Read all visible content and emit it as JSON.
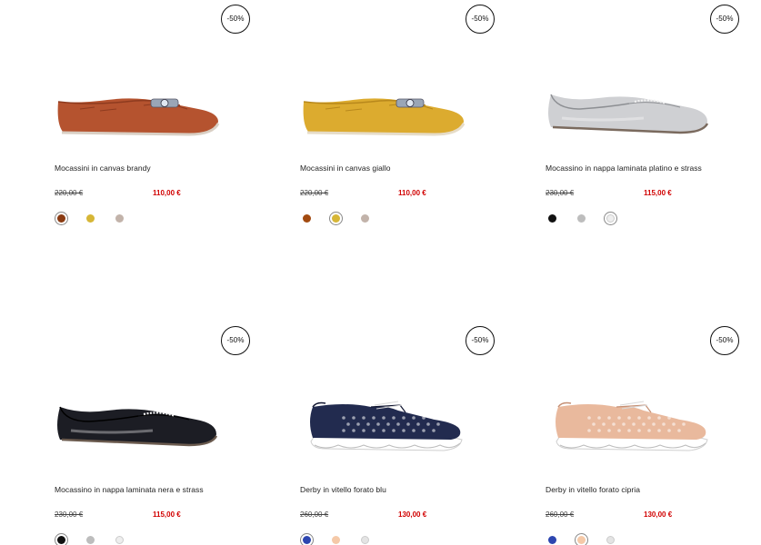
{
  "products": [
    {
      "badge": "-50%",
      "name": "Mocassini in canvas brandy",
      "old_price": "220,00 €",
      "new_price": "110,00 €",
      "colors": [
        "#8a3b12",
        "#d6b636",
        "#c2b3aa"
      ],
      "selected": 0,
      "shoe": {
        "type": "loafer",
        "color": "#b5532f",
        "dark": "#8e3b1f",
        "sole": "#d9cfc4",
        "ornament": true
      }
    },
    {
      "badge": "-50%",
      "name": "Mocassini in canvas giallo",
      "old_price": "220,00 €",
      "new_price": "110,00 €",
      "colors": [
        "#a24a10",
        "#d6b636",
        "#c2b3aa"
      ],
      "selected": 1,
      "shoe": {
        "type": "loafer",
        "color": "#dcab2f",
        "dark": "#b8881c",
        "sole": "#e6dcc8",
        "ornament": true
      }
    },
    {
      "badge": "-50%",
      "name": "Mocassino in nappa laminata platino e strass",
      "old_price": "230,00 €",
      "new_price": "115,00 €",
      "colors": [
        "#111111",
        "#bdbdbd",
        "#eeeeee"
      ],
      "selected": 2,
      "shoe": {
        "type": "slipper",
        "color": "#cfd0d3",
        "dark": "#8d8f93",
        "sole": "#7a6a5e",
        "ornament": true
      }
    },
    {
      "badge": "-50%",
      "name": "Mocassino in nappa laminata nera e strass",
      "old_price": "230,00 €",
      "new_price": "115,00 €",
      "colors": [
        "#111111",
        "#bdbdbd",
        "#eeeeee"
      ],
      "selected": 0,
      "shoe": {
        "type": "slipper",
        "color": "#1c1d24",
        "dark": "#000000",
        "sole": "#6a5a4e",
        "ornament": true
      }
    },
    {
      "badge": "-50%",
      "name": "Derby in vitello forato blu",
      "old_price": "260,00 €",
      "new_price": "130,00 €",
      "colors": [
        "#2d46b0",
        "#f5c9a8",
        "#e4e4e4"
      ],
      "selected": 0,
      "shoe": {
        "type": "derby",
        "color": "#222b4f",
        "dark": "#101530",
        "sole": "#ffffff",
        "ornament": false
      }
    },
    {
      "badge": "-50%",
      "name": "Derby in vitello forato cipria",
      "old_price": "260,00 €",
      "new_price": "130,00 €",
      "colors": [
        "#2d46b0",
        "#f5c9a8",
        "#e4e4e4"
      ],
      "selected": 1,
      "shoe": {
        "type": "derby",
        "color": "#e9b99d",
        "dark": "#c58f73",
        "sole": "#ffffff",
        "ornament": false
      }
    }
  ]
}
